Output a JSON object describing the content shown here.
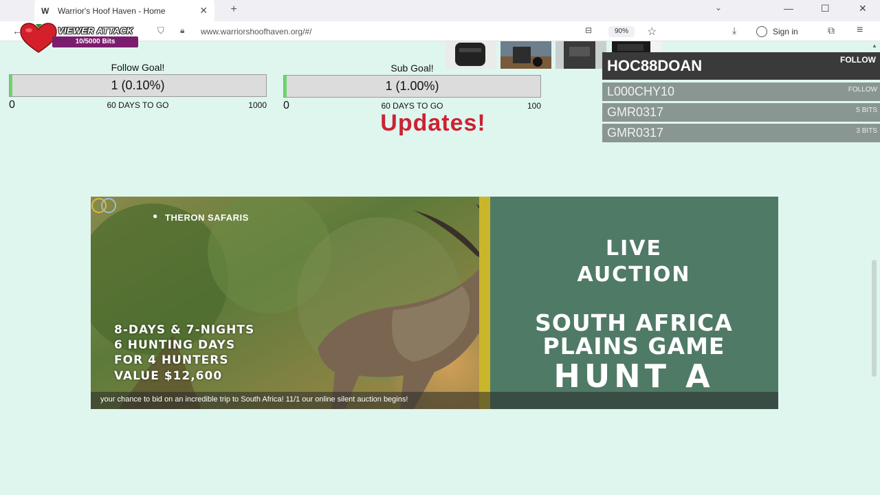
{
  "browser": {
    "tab_title": "Warrior's Hoof Haven - Home",
    "url": "www.warriorshoofhaven.org/#/",
    "zoom": "90%",
    "sign_in": "Sign in"
  },
  "overlay": {
    "title": "VIEWER ATTACK",
    "bits": "10/5000 Bits"
  },
  "follow_goal": {
    "label": "Follow Goal!",
    "value": "1 (0.10%)",
    "progress": 0.001,
    "min": "0",
    "days": "60 DAYS TO GO",
    "max": "1000"
  },
  "sub_goal": {
    "label": "Sub Goal!",
    "value": "1 (1.00%)",
    "progress": 0.01,
    "min": "0",
    "days": "60 DAYS TO GO",
    "max": "100"
  },
  "updates_heading": "Updates!",
  "events": {
    "top": {
      "name": "HOC88DOAN",
      "tag": "FOLLOW"
    },
    "items": [
      {
        "name": "L000CHY10",
        "tag": "FOLLOW"
      },
      {
        "name": "GMR0317",
        "tag": "5 BITS"
      },
      {
        "name": "GMR0317",
        "tag": "3 BITS"
      }
    ]
  },
  "banner": {
    "brand": "THERON SAFARIS",
    "left_lines": [
      "8-DAYS & 7-NIGHTS",
      "6 HUNTING DAYS",
      "FOR 4 HUNTERS",
      "VALUE $12,600"
    ],
    "live": "LIVE",
    "auction": "AUCTION",
    "line1": "SOUTH AFRICA",
    "line2": "PLAINS GAME",
    "line3": "HUNT A",
    "caption": "your chance to bid on an incredible trip to South Africa! 11/1 our online silent auction begins!",
    "panel_color": "#4f7a66",
    "stripe_color": "#c9b62a"
  }
}
